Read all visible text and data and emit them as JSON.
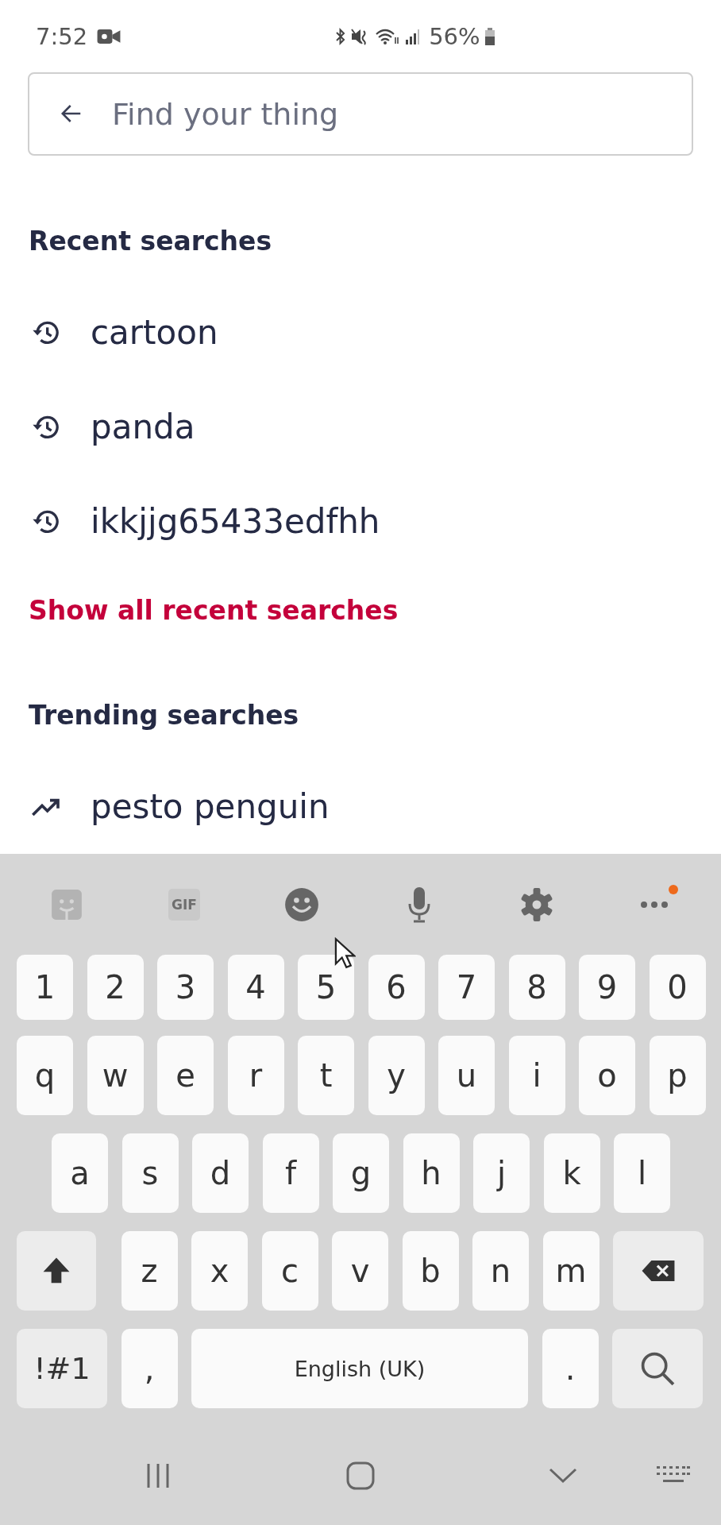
{
  "status_bar": {
    "time": "7:52",
    "battery": "56%"
  },
  "search": {
    "placeholder": "Find your thing"
  },
  "recent": {
    "title": "Recent searches",
    "items": [
      {
        "text": "cartoon",
        "kind": "history"
      },
      {
        "text": "panda",
        "kind": "history"
      },
      {
        "text": "ikkjjg65433edfhh",
        "kind": "history"
      }
    ],
    "show_all": "Show all recent searches"
  },
  "trending": {
    "title": "Trending searches",
    "items": [
      {
        "text": "pesto penguin",
        "kind": "trending"
      }
    ]
  },
  "keyboard": {
    "toolbar": [
      {
        "kind": "sticker",
        "disabled": true
      },
      {
        "kind": "gif",
        "label": "GIF",
        "disabled": true
      },
      {
        "kind": "emoji",
        "disabled": false
      },
      {
        "kind": "mic",
        "disabled": false
      },
      {
        "kind": "settings",
        "disabled": false
      },
      {
        "kind": "more",
        "disabled": false,
        "notification": true
      }
    ],
    "rows": [
      {
        "keys": [
          {
            "kind": "char",
            "label": "1"
          },
          {
            "kind": "char",
            "label": "2"
          },
          {
            "kind": "char",
            "label": "3"
          },
          {
            "kind": "char",
            "label": "4"
          },
          {
            "kind": "char",
            "label": "5"
          },
          {
            "kind": "char",
            "label": "6"
          },
          {
            "kind": "char",
            "label": "7"
          },
          {
            "kind": "char",
            "label": "8"
          },
          {
            "kind": "char",
            "label": "9"
          },
          {
            "kind": "char",
            "label": "0"
          }
        ]
      },
      {
        "keys": [
          {
            "kind": "char",
            "label": "q"
          },
          {
            "kind": "char",
            "label": "w"
          },
          {
            "kind": "char",
            "label": "e"
          },
          {
            "kind": "char",
            "label": "r"
          },
          {
            "kind": "char",
            "label": "t"
          },
          {
            "kind": "char",
            "label": "y"
          },
          {
            "kind": "char",
            "label": "u"
          },
          {
            "kind": "char",
            "label": "i"
          },
          {
            "kind": "char",
            "label": "o"
          },
          {
            "kind": "char",
            "label": "p"
          }
        ]
      },
      {
        "keys": [
          {
            "kind": "char",
            "label": "a"
          },
          {
            "kind": "char",
            "label": "s"
          },
          {
            "kind": "char",
            "label": "d"
          },
          {
            "kind": "char",
            "label": "f"
          },
          {
            "kind": "char",
            "label": "g"
          },
          {
            "kind": "char",
            "label": "h"
          },
          {
            "kind": "char",
            "label": "j"
          },
          {
            "kind": "char",
            "label": "k"
          },
          {
            "kind": "char",
            "label": "l"
          }
        ]
      },
      {
        "keys": [
          {
            "kind": "shift"
          },
          {
            "kind": "char",
            "label": "z"
          },
          {
            "kind": "char",
            "label": "x"
          },
          {
            "kind": "char",
            "label": "c"
          },
          {
            "kind": "char",
            "label": "v"
          },
          {
            "kind": "char",
            "label": "b"
          },
          {
            "kind": "char",
            "label": "n"
          },
          {
            "kind": "char",
            "label": "m"
          },
          {
            "kind": "backspace"
          }
        ]
      },
      {
        "keys": [
          {
            "kind": "symbols",
            "label": "!#1"
          },
          {
            "kind": "char",
            "label": ","
          },
          {
            "kind": "space",
            "label": "English (UK)"
          },
          {
            "kind": "char",
            "label": "."
          },
          {
            "kind": "search"
          }
        ]
      }
    ]
  }
}
